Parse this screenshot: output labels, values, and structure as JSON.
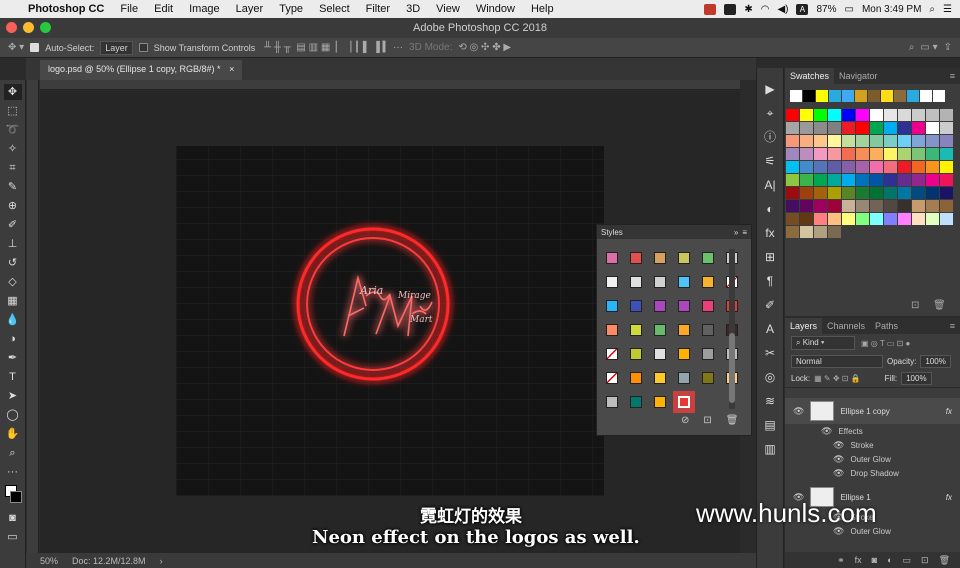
{
  "menubar": {
    "app_name": "Photoshop CC",
    "items": [
      "File",
      "Edit",
      "Image",
      "Layer",
      "Type",
      "Select",
      "Filter",
      "3D",
      "View",
      "Window",
      "Help"
    ],
    "battery": "87%",
    "clock": "Mon 3:49 PM"
  },
  "window": {
    "title": "Adobe Photoshop CC 2018"
  },
  "options": {
    "auto_select_label": "Auto-Select:",
    "auto_select_value": "Layer",
    "transform_label": "Show Transform Controls",
    "mode_3d": "3D Mode:"
  },
  "document": {
    "tab_label": "logo.psd @ 50% (Ellipse 1 copy, RGB/8#) *",
    "zoom": "50%",
    "doc_size": "Doc: 12.2M/12.8M",
    "artwork_text": [
      "Aria",
      "Mirage",
      "Mart"
    ]
  },
  "panels": {
    "swatches_tab": "Swatches",
    "navigator_tab": "Navigator",
    "layers_tab": "Layers",
    "channels_tab": "Channels",
    "paths_tab": "Paths",
    "kind_filter": "Kind",
    "blend_mode": "Normal",
    "opacity_label": "Opacity:",
    "opacity_value": "100%",
    "lock_label": "Lock:",
    "fill_label": "Fill:",
    "fill_value": "100%",
    "styles_title": "Styles"
  },
  "layers": [
    {
      "name": "Ellipse 1 copy",
      "effects_label": "Effects",
      "effects": [
        "Stroke",
        "Outer Glow",
        "Drop Shadow"
      ]
    },
    {
      "name": "Ellipse 1",
      "effects": [
        "Stroke",
        "Outer Glow"
      ]
    }
  ],
  "subtitle": {
    "chinese": "霓虹灯的效果",
    "english": "Neon effect on the logos as well."
  },
  "watermark": "www.hunls.com",
  "colors": {
    "neon_red": "#ff2a2a",
    "panel_bg": "#3c3c3c"
  }
}
